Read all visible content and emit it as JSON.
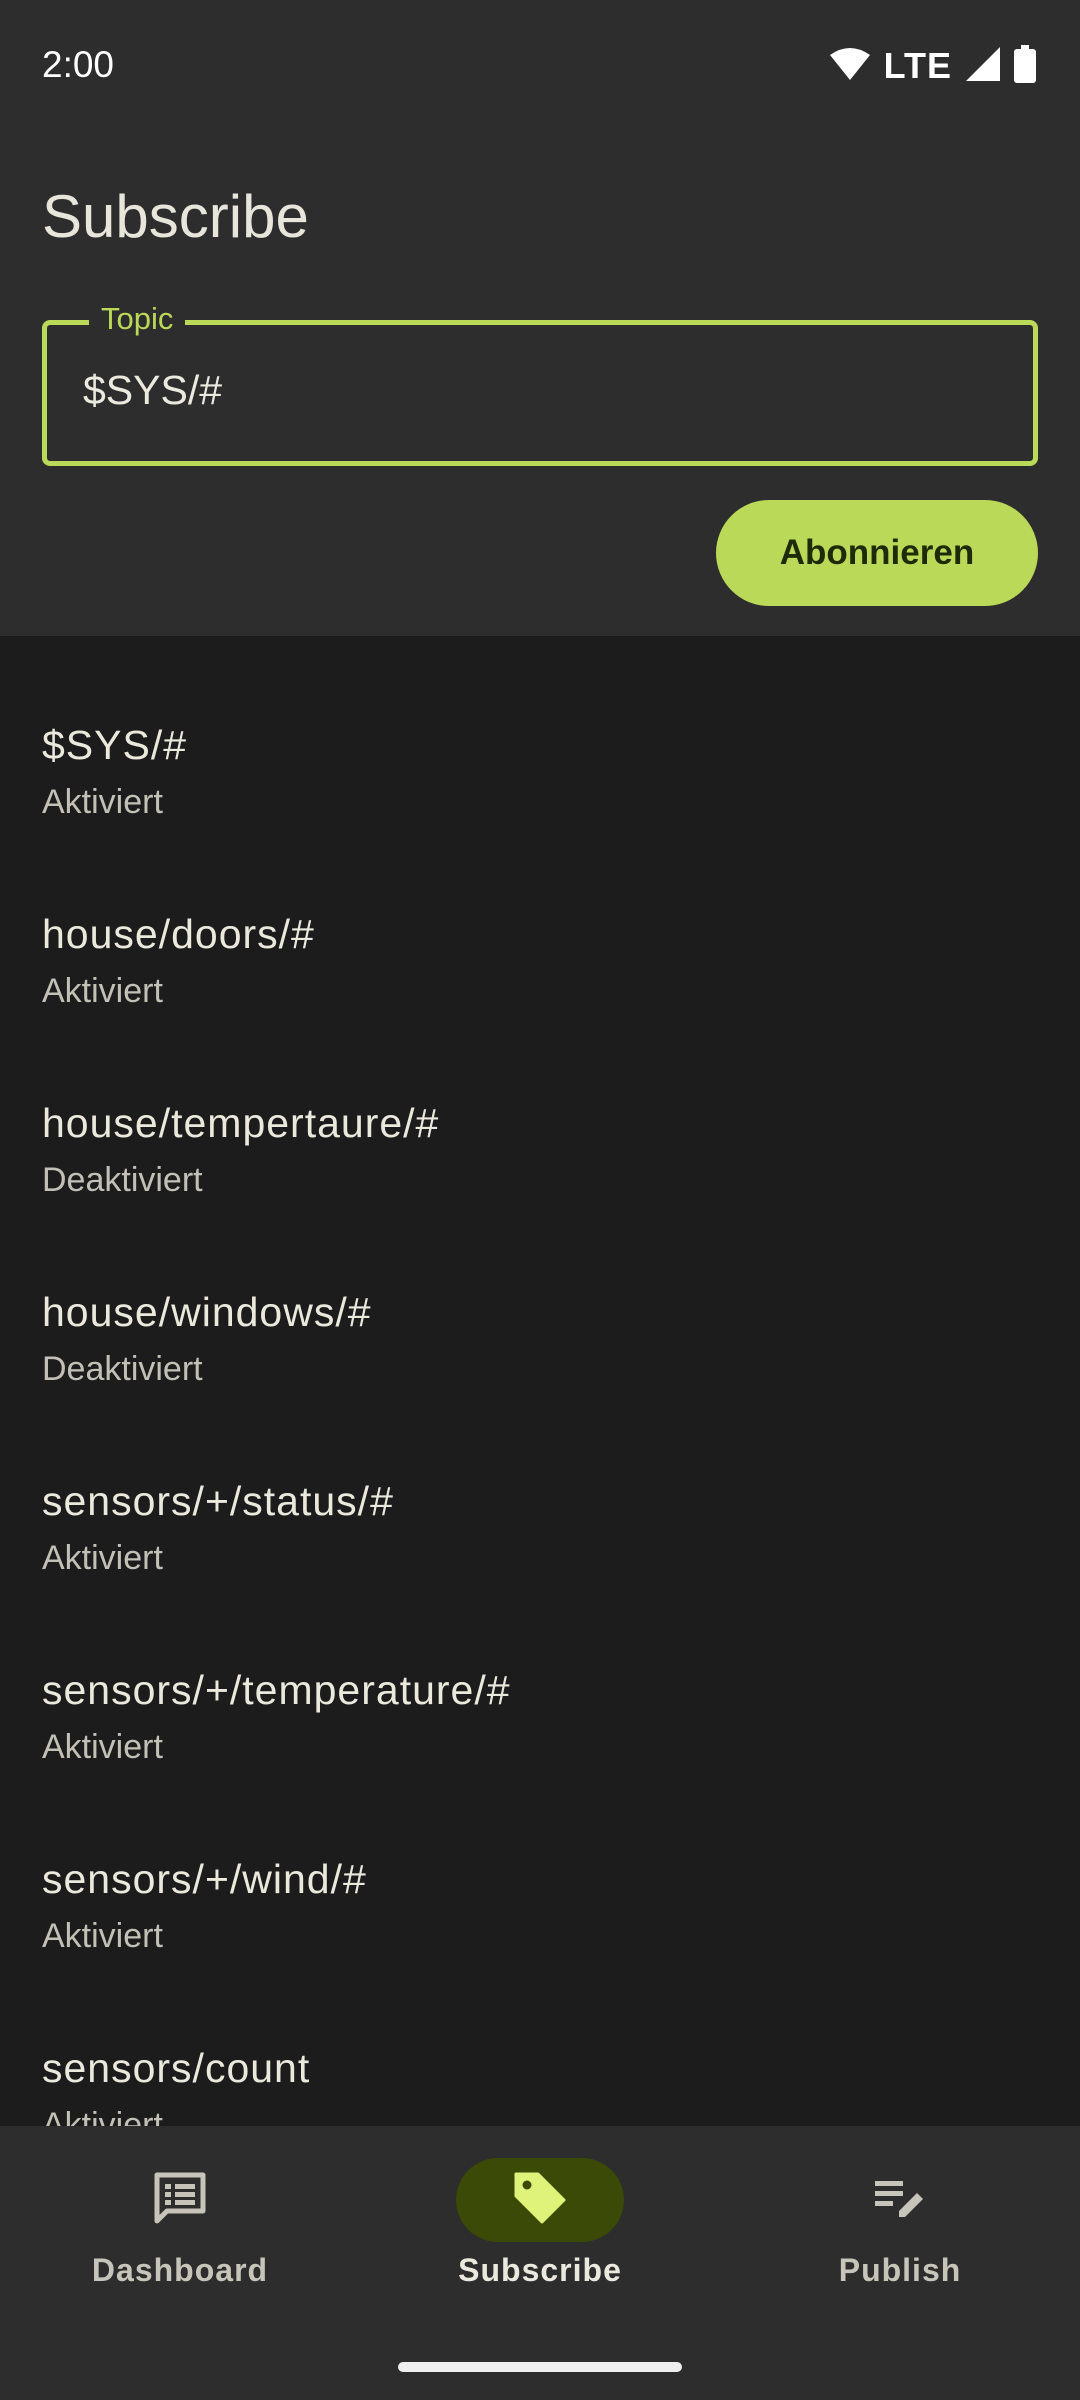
{
  "status_bar": {
    "time": "2:00",
    "network": "LTE"
  },
  "header": {
    "title": "Subscribe",
    "topic_label": "Topic",
    "topic_value": "$SYS/#",
    "subscribe_button": "Abonnieren"
  },
  "topics": [
    {
      "topic": "$SYS/#",
      "status": "Aktiviert"
    },
    {
      "topic": "house/doors/#",
      "status": "Aktiviert"
    },
    {
      "topic": "house/tempertaure/#",
      "status": "Deaktiviert"
    },
    {
      "topic": "house/windows/#",
      "status": "Deaktiviert"
    },
    {
      "topic": "sensors/+/status/#",
      "status": "Aktiviert"
    },
    {
      "topic": "sensors/+/temperature/#",
      "status": "Aktiviert"
    },
    {
      "topic": "sensors/+/wind/#",
      "status": "Aktiviert"
    },
    {
      "topic": "sensors/count",
      "status": "Aktiviert"
    }
  ],
  "bottom_nav": {
    "items": [
      {
        "label": "Dashboard",
        "icon": "list-article-icon",
        "active": false
      },
      {
        "label": "Subscribe",
        "icon": "tag-icon",
        "active": true
      },
      {
        "label": "Publish",
        "icon": "edit-note-icon",
        "active": false
      }
    ]
  },
  "colors": {
    "accent": "#bbd958",
    "active_nav_pill": "#3b4a06",
    "surface": "#2d2d2e",
    "background": "#1c1c1d"
  }
}
